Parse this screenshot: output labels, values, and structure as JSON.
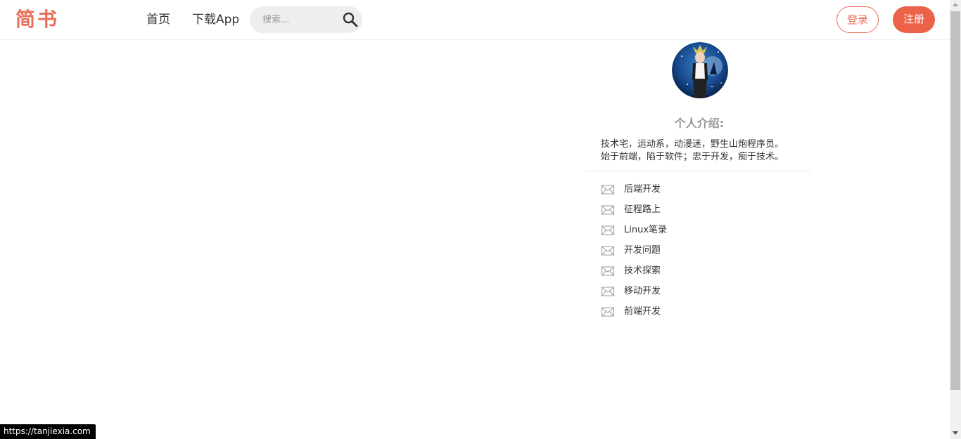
{
  "header": {
    "logo": "简书",
    "nav": {
      "home": "首页",
      "download_app": "下载App"
    },
    "search": {
      "placeholder": "搜索...",
      "icon": "search-icon"
    },
    "login_label": "登录",
    "register_label": "注册",
    "brand_color": "#ea6f5a"
  },
  "sidebar": {
    "avatar_icon": "avatar-anime-character",
    "intro_title": "个人介绍:",
    "intro_lines": [
      "技术宅，运动系，动漫迷，野生山炮程序员。",
      "始于前端，陷于软件；忠于开发，痴于技术。"
    ],
    "categories": [
      {
        "label": "后端开发",
        "icon": "envelope-icon"
      },
      {
        "label": "征程路上",
        "icon": "envelope-icon"
      },
      {
        "label": "Linux笔录",
        "icon": "envelope-icon"
      },
      {
        "label": "开发问题",
        "icon": "envelope-icon"
      },
      {
        "label": "技术探索",
        "icon": "envelope-icon"
      },
      {
        "label": "移动开发",
        "icon": "envelope-icon"
      },
      {
        "label": "前端开发",
        "icon": "envelope-icon"
      }
    ]
  },
  "status_bar": {
    "url": "https://tanjiexia.com"
  }
}
